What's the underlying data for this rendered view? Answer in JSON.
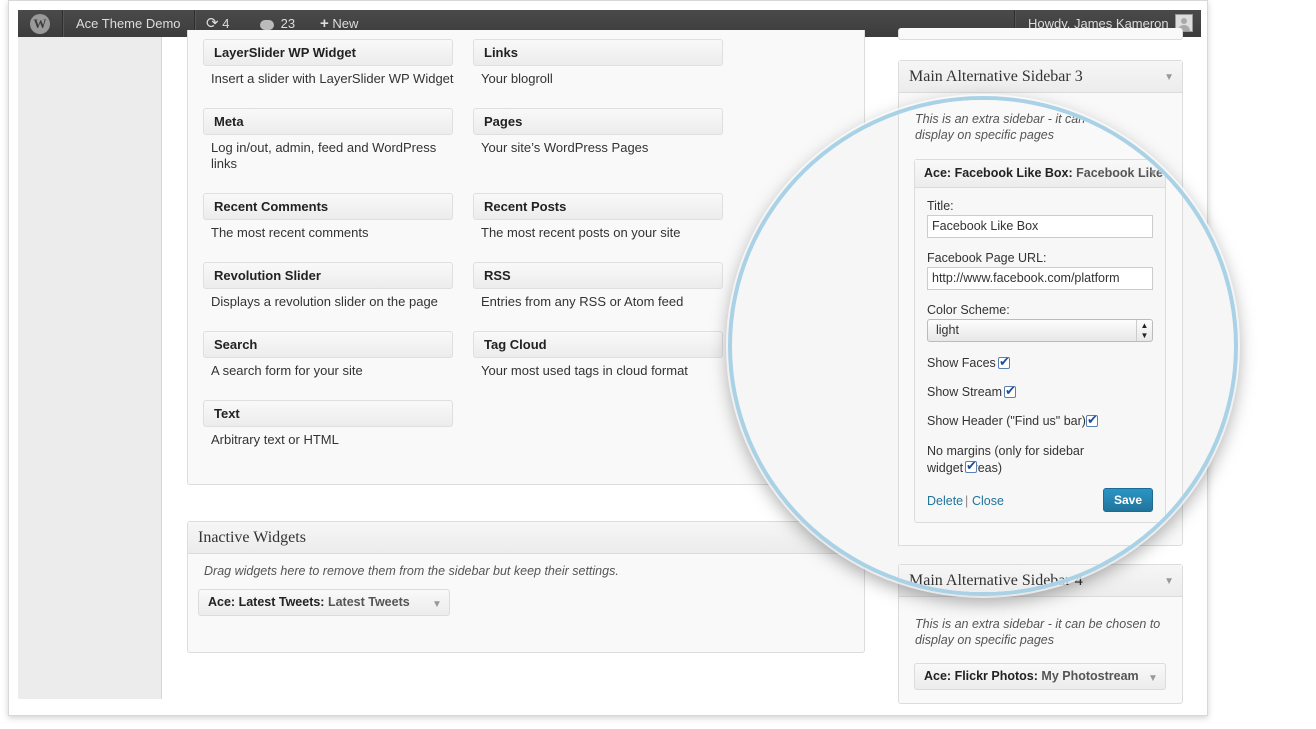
{
  "adminbar": {
    "site_name": "Ace Theme Demo",
    "updates_count": "4",
    "comments_count": "23",
    "new_label": "New",
    "howdy": "Howdy, James Kameron"
  },
  "available_widgets": [
    {
      "name": "LayerSlider WP Widget",
      "desc": "Insert a slider with LayerSlider WP Widget"
    },
    {
      "name": "Links",
      "desc": "Your blogroll"
    },
    {
      "name": "Meta",
      "desc": "Log in/out, admin, feed and WordPress links"
    },
    {
      "name": "Pages",
      "desc": "Your site’s WordPress Pages"
    },
    {
      "name": "Recent Comments",
      "desc": "The most recent comments"
    },
    {
      "name": "Recent Posts",
      "desc": "The most recent posts on your site"
    },
    {
      "name": "Revolution Slider",
      "desc": "Displays a revolution slider on the page"
    },
    {
      "name": "RSS",
      "desc": "Entries from any RSS or Atom feed"
    },
    {
      "name": "Search",
      "desc": "A search form for your site"
    },
    {
      "name": "Tag Cloud",
      "desc": "Your most used tags in cloud format"
    },
    {
      "name": "Text",
      "desc": "Arbitrary text or HTML"
    }
  ],
  "inactive": {
    "title": "Inactive Widgets",
    "note": "Drag widgets here to remove them from the sidebar but keep their settings.",
    "widget_name": "Ace: Latest Tweets:",
    "widget_title": "Latest Tweets"
  },
  "sidebar3": {
    "title": "Main Alternative Sidebar 3",
    "note": "This is an extra sidebar - it can be chosen to display on specific pages",
    "widget_name": "Ace: Facebook Like Box:",
    "widget_title": "Facebook Like Box",
    "form": {
      "title_label": "Title:",
      "title_value": "Facebook Like Box",
      "url_label": "Facebook Page URL:",
      "url_value": "http://www.facebook.com/platform",
      "scheme_label": "Color Scheme:",
      "scheme_value": "light",
      "show_faces": "Show Faces",
      "show_stream": "Show Stream",
      "show_header": "Show Header (\"Find us\" bar)",
      "no_margins": "No margins (only for sidebar widget areas)",
      "delete": "Delete",
      "separator": "|",
      "close": "Close",
      "save": "Save"
    }
  },
  "sidebar4": {
    "title": "Main Alternative Sidebar 4",
    "note": "This is an extra sidebar - it can be chosen to display on specific pages",
    "widget_name": "Ace: Flickr Photos:",
    "widget_title": "My Photostream"
  }
}
